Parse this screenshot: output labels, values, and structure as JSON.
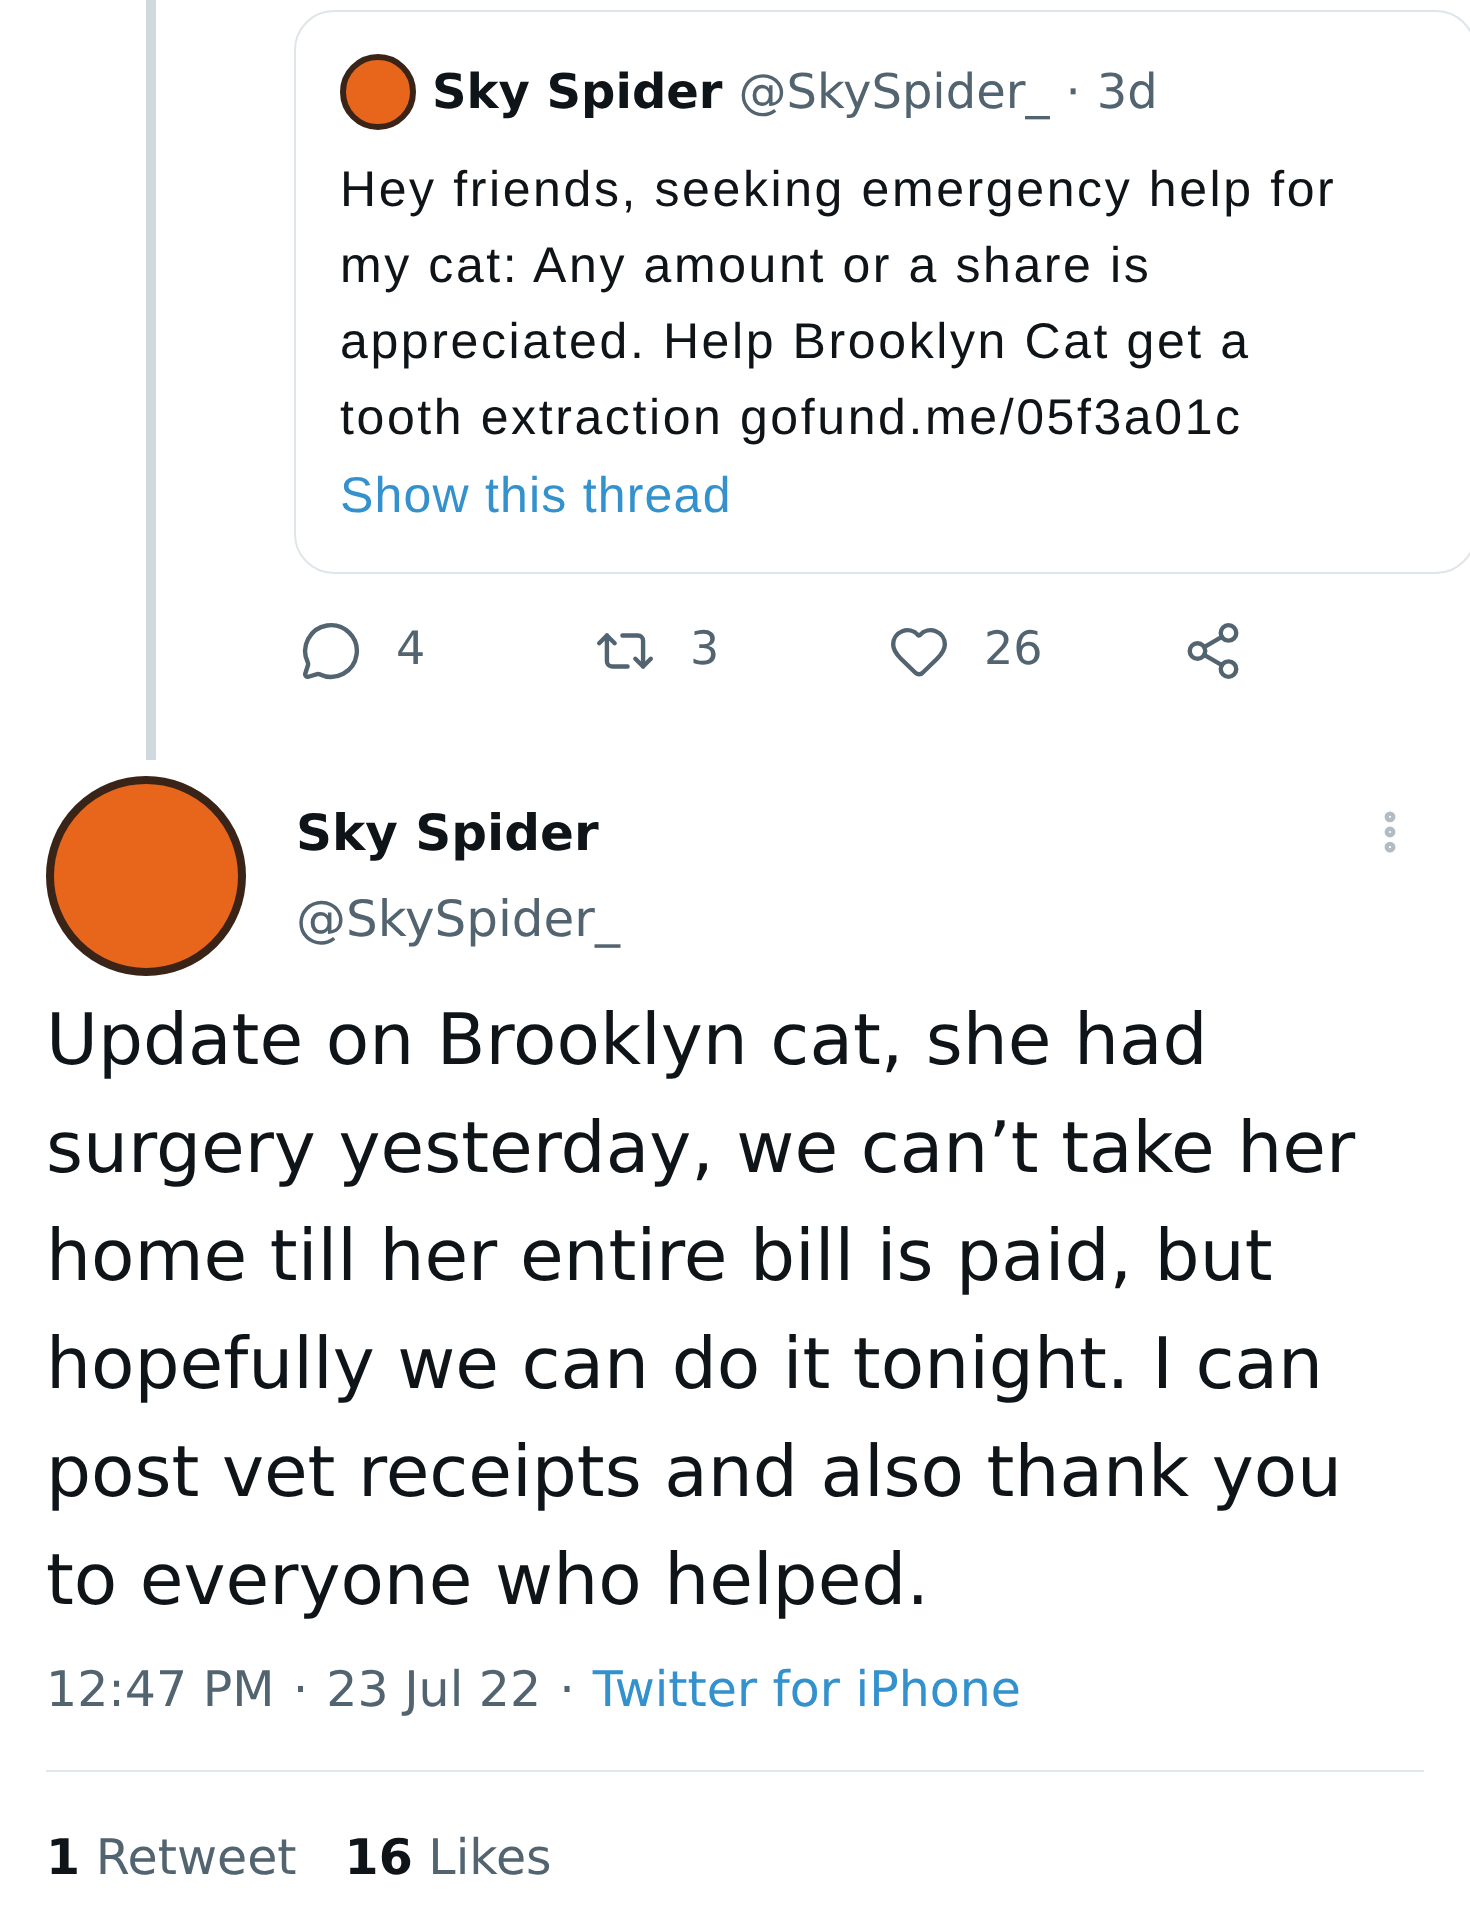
{
  "quoted_tweet": {
    "name": "Sky Spider",
    "handle": "@SkySpider_",
    "separator": "·",
    "age": "3d",
    "text": "Hey friends, seeking emergency help for my cat: Any amount or a share is appreciated. Help Brooklyn Cat get a tooth extraction gofund.me/05f3a01c",
    "thread_link": "Show this thread"
  },
  "actions": [
    {
      "kind": "reply",
      "count": "4"
    },
    {
      "kind": "retweet",
      "count": "3"
    },
    {
      "kind": "like",
      "count": "26"
    },
    {
      "kind": "share"
    }
  ],
  "tweet": {
    "name": "Sky Spider",
    "handle": "@SkySpider_",
    "text": "Update on Brooklyn cat, she had surgery yesterday, we can’t take her home till her entire bill is paid, but hopefully we can do it tonight. I can post vet receipts and also thank you to everyone who helped.",
    "time": "12:47 PM",
    "separator": "·",
    "date": "23 Jul 22",
    "source": "Twitter for iPhone"
  },
  "stats": [
    {
      "count": "1",
      "label": "Retweet"
    },
    {
      "count": "16",
      "label": "Likes"
    }
  ]
}
